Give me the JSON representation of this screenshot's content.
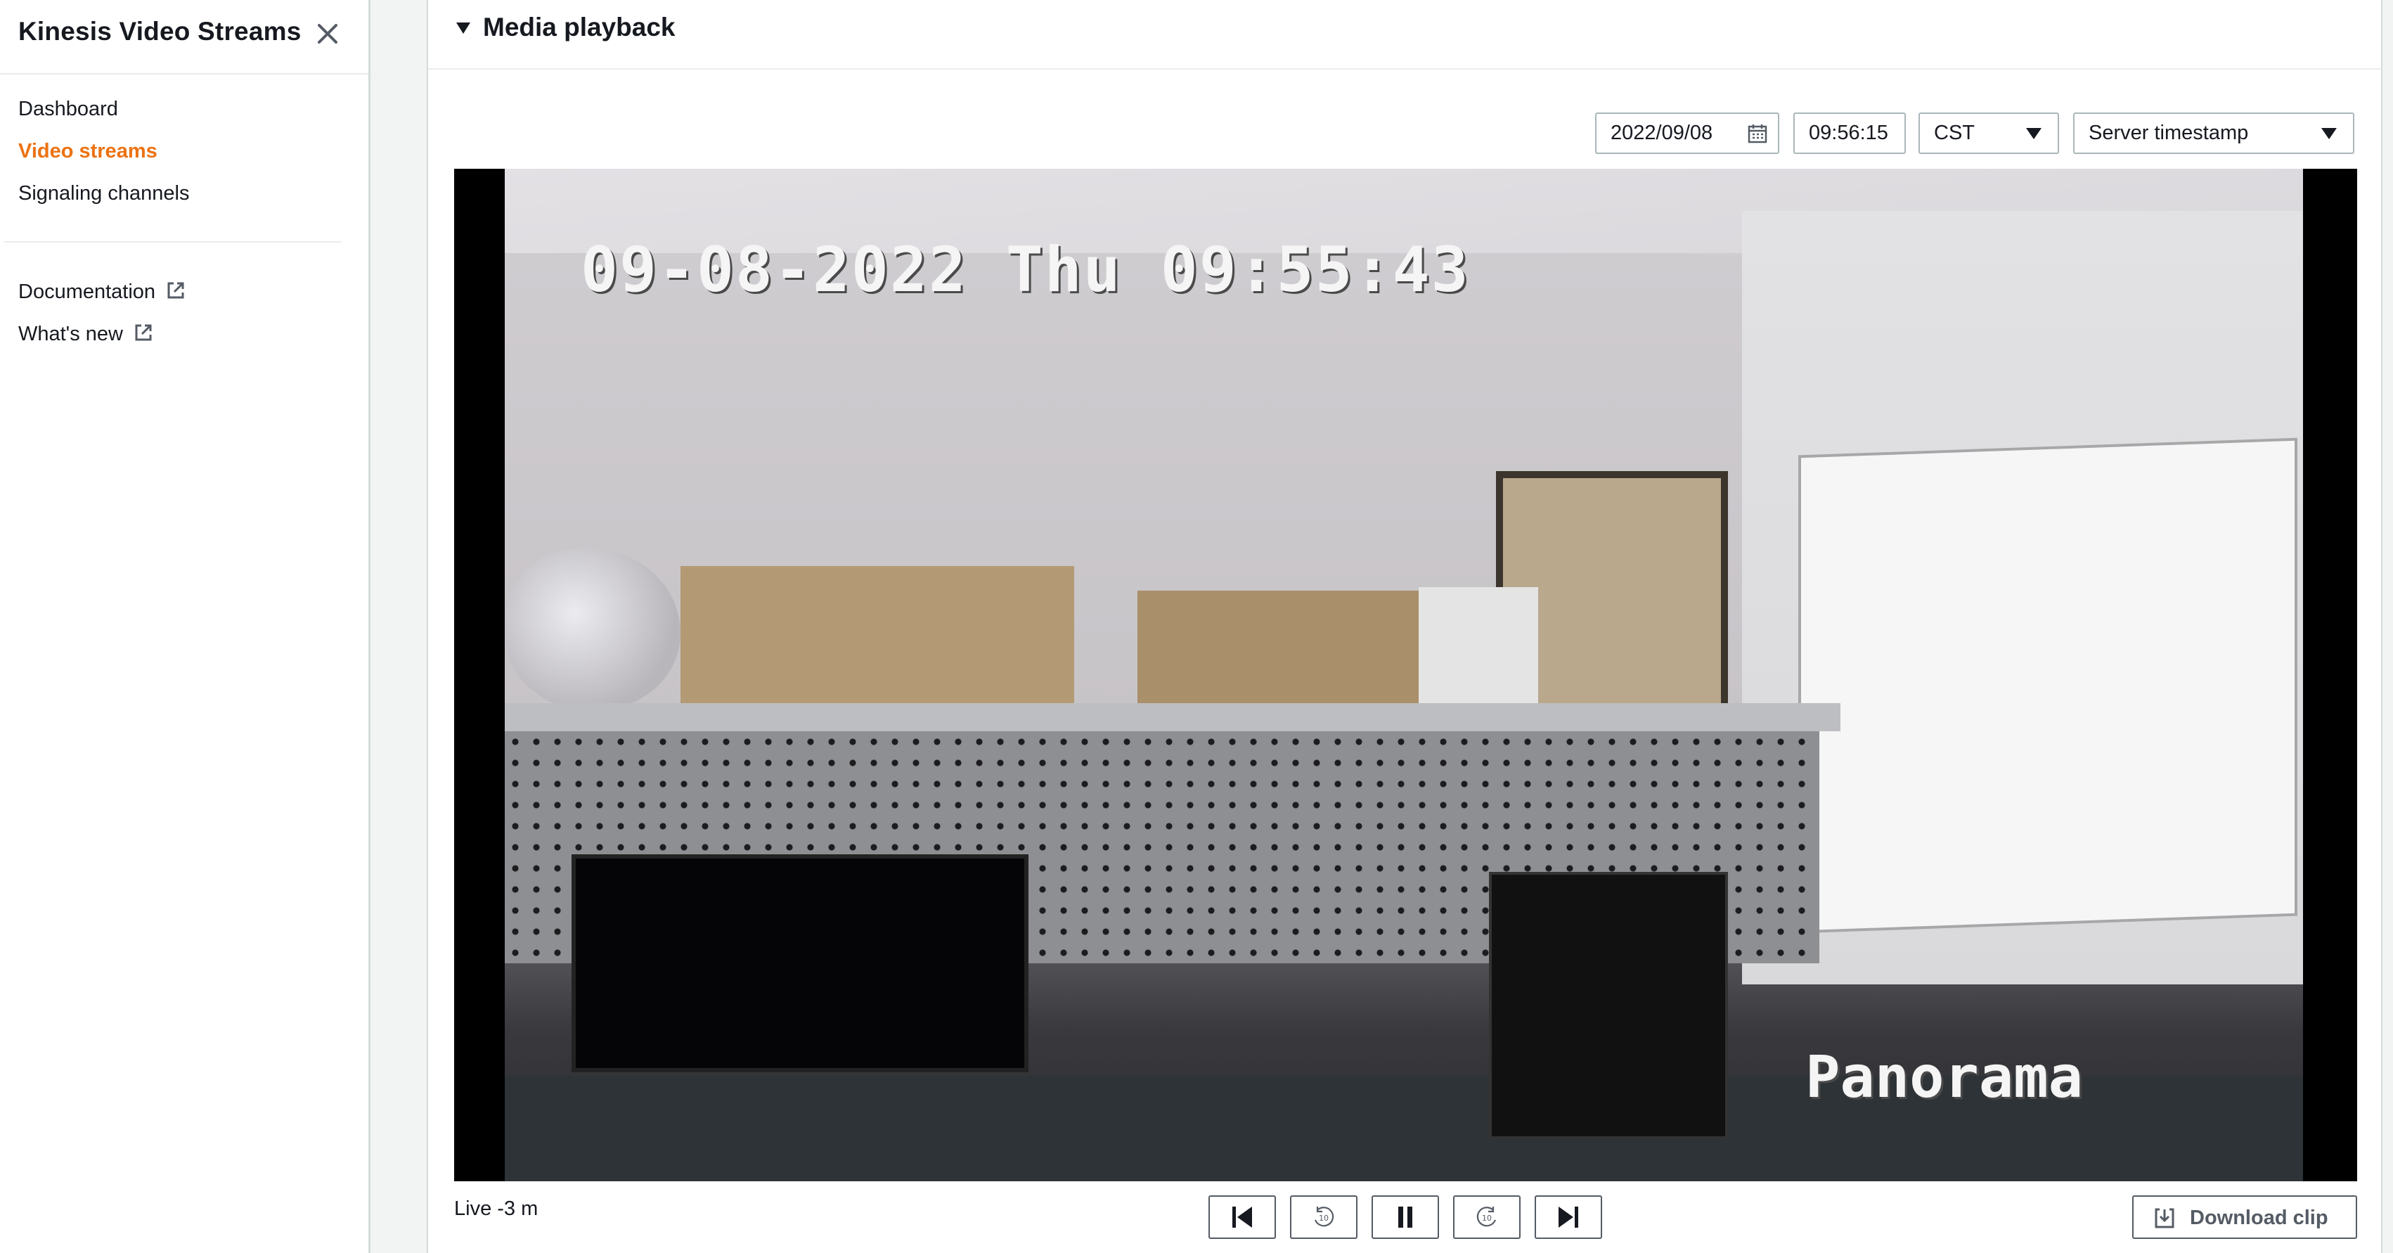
{
  "sidebar": {
    "title": "Kinesis Video Streams",
    "items": [
      {
        "label": "Dashboard",
        "active": false
      },
      {
        "label": "Video streams",
        "active": true
      },
      {
        "label": "Signaling channels",
        "active": false
      }
    ],
    "links": [
      {
        "label": "Documentation",
        "icon": "external-link-icon"
      },
      {
        "label": "What's new",
        "icon": "external-link-icon"
      }
    ]
  },
  "panel": {
    "title": "Media playback"
  },
  "controls": {
    "date": "2022/09/08",
    "time": "09:56:15",
    "timezone": "CST",
    "timestamp_type": "Server timestamp"
  },
  "video": {
    "overlay_timestamp": "09-08-2022 Thu 09:55:43",
    "overlay_label": "Panorama"
  },
  "playback": {
    "live_status": "Live -3 m",
    "download_label": "Download clip"
  },
  "colors": {
    "accent": "#ec7211",
    "text": "#16191f",
    "border": "#aab7b8"
  }
}
